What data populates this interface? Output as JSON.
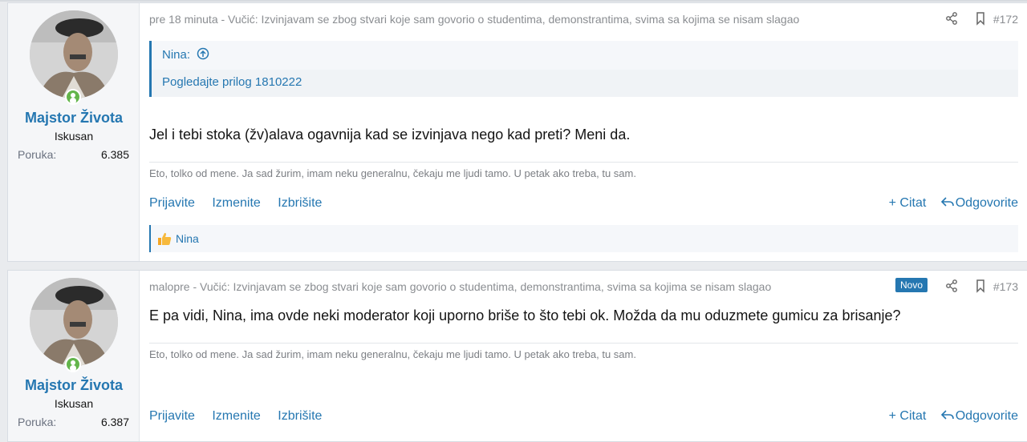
{
  "posts": [
    {
      "author": "Majstor Života",
      "user_title": "Iskusan",
      "stat_label": "Poruka:",
      "stat_value": "6.385",
      "meta": "pre 18 minuta - Vučić: Izvinjavam se zbog stvari koje sam govorio o studentima, demonstrantima, svima sa kojima se nisam slagao",
      "number": "#172",
      "quote_author": "Nina:",
      "quote_link": "Pogledajte prilog 1810222",
      "message": "Jel i tebi stoka (žv)alava ogavnija kad se izvinjava nego kad preti? Meni da.",
      "signature": "Eto, tolko od mene. Ja sad žurim, imam neku generalnu, čekaju me ljudi tamo. U petak ako treba, tu sam.",
      "actions": {
        "report": "Prijavite",
        "edit": "Izmenite",
        "delete": "Izbrišite",
        "quote": "+ Citat",
        "reply": "Odgovorite"
      },
      "reaction_user": "Nina"
    },
    {
      "author": "Majstor Života",
      "user_title": "Iskusan",
      "stat_label": "Poruka:",
      "stat_value": "6.387",
      "meta": "malopre - Vučić: Izvinjavam se zbog stvari koje sam govorio o studentima, demonstrantima, svima sa kojima se nisam slagao",
      "badge": "Novo",
      "number": "#173",
      "message": "E pa vidi, Nina, ima ovde neki moderator koji uporno briše to što tebi ok. Možda da mu oduzmete gumicu za brisanje?",
      "signature": "Eto, tolko od mene. Ja sad žurim, imam neku generalnu, čekaju me ljudi tamo. U petak ako treba, tu sam.",
      "actions": {
        "report": "Prijavite",
        "edit": "Izmenite",
        "delete": "Izbrišite",
        "quote": "+ Citat",
        "reply": "Odgovorite"
      }
    }
  ],
  "icons": {
    "share": "share-icon",
    "bookmark": "bookmark-icon",
    "reply": "reply-arrow-icon",
    "like": "thumbs-up-icon",
    "quote_jump": "arrow-up-circle-icon",
    "online": "online-status-icon"
  },
  "colors": {
    "link": "#2577b1",
    "online": "#63b54b",
    "meta": "#8a8d91"
  }
}
